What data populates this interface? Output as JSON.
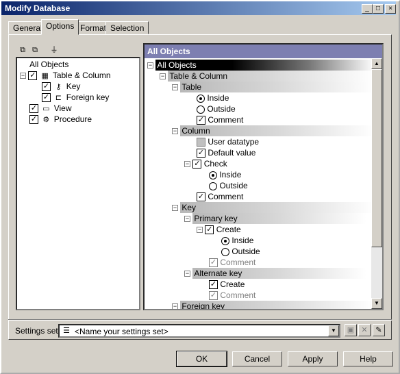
{
  "window": {
    "title": "Modify Database"
  },
  "titlebar_buttons": [
    "_",
    "□",
    "×"
  ],
  "tabs": [
    "General",
    "Options",
    "Format",
    "Selection"
  ],
  "left_tree": {
    "root": "All Objects",
    "items": [
      "Table & Column",
      "Key",
      "Foreign key",
      "View",
      "Procedure"
    ]
  },
  "right": {
    "header": "All Objects",
    "rows": [
      "All Objects",
      "Table & Column",
      "Table",
      "Inside",
      "Outside",
      "Comment",
      "Column",
      "User datatype",
      "Default value",
      "Check",
      "Inside",
      "Outside",
      "Comment",
      "Key",
      "Primary key",
      "Create",
      "Inside",
      "Outside",
      "Comment",
      "Alternate key",
      "Create",
      "Comment",
      "Foreign key"
    ]
  },
  "settings": {
    "label": "Settings set:",
    "value": "<Name your settings set>"
  },
  "buttons": {
    "ok": "OK",
    "cancel": "Cancel",
    "apply": "Apply",
    "help": "Help"
  }
}
